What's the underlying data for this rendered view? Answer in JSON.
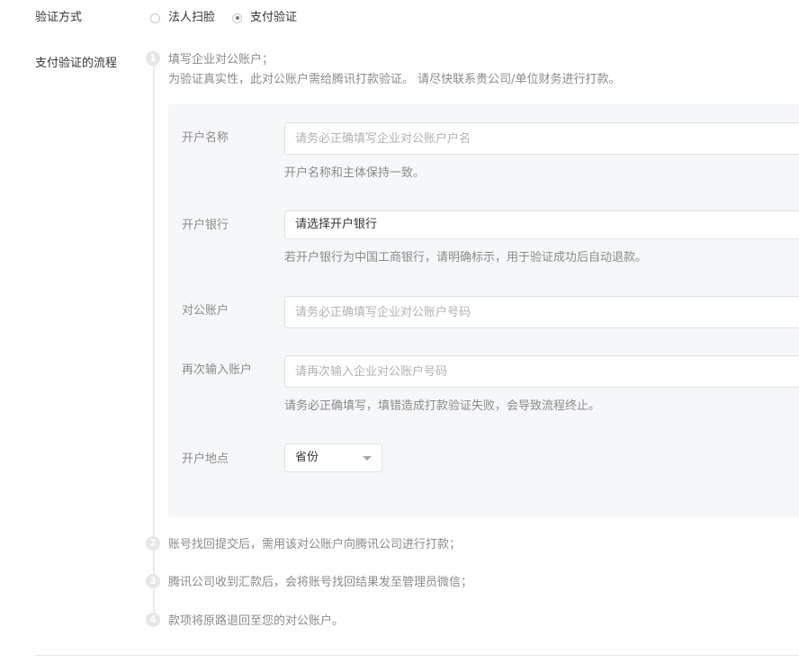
{
  "verify_method": {
    "label": "验证方式",
    "options": [
      {
        "label": "法人扫脸",
        "checked": false
      },
      {
        "label": "支付验证",
        "checked": true
      }
    ]
  },
  "flow": {
    "label": "支付验证的流程",
    "steps": [
      {
        "num": "1",
        "line1": "填写企业对公账户；",
        "line2": "为验证真实性，此对公账户需给腾讯打款验证。 请尽快联系贵公司/单位财务进行打款。"
      },
      {
        "num": "2",
        "text": "账号找回提交后，需用该对公账户向腾讯公司进行打款；"
      },
      {
        "num": "3",
        "text": "腾讯公司收到汇款后，会将账号找回结果发至管理员微信；"
      },
      {
        "num": "4",
        "text": "款项将原路退回至您的对公账户。"
      }
    ]
  },
  "form": {
    "account_name": {
      "label": "开户名称",
      "placeholder": "请务必正确填写企业对公账户户名",
      "tip": "开户名称和主体保持一致。"
    },
    "bank": {
      "label": "开户银行",
      "value": "请选择开户银行",
      "tip": "若开户银行为中国工商银行，请明确标示，用于验证成功后自动退款。"
    },
    "account": {
      "label": "对公账户",
      "placeholder": "请务必正确填写企业对公账户号码"
    },
    "account_confirm": {
      "label": "再次输入账户",
      "placeholder": "请再次输入企业对公账户号码",
      "tip": "请务必正确填写，填错造成打款验证失败，会导致流程终止。"
    },
    "location": {
      "label": "开户地点",
      "province": "省份"
    }
  }
}
